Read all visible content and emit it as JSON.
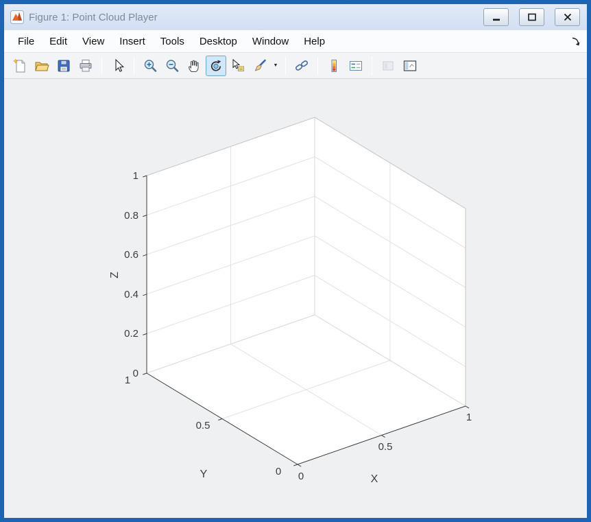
{
  "window": {
    "title": "Figure 1: Point Cloud Player",
    "app_icon": "matlab-logo",
    "controls": [
      "minimize",
      "maximize",
      "close"
    ]
  },
  "menu": {
    "items": [
      "File",
      "Edit",
      "View",
      "Insert",
      "Tools",
      "Desktop",
      "Window",
      "Help"
    ],
    "dock_icon": "dock-figure-arrow"
  },
  "toolbar": {
    "buttons": [
      "new-figure",
      "open-file",
      "save-figure",
      "print-figure",
      "edit-plot",
      "zoom-in",
      "zoom-out",
      "pan",
      "rotate-3d",
      "data-cursor",
      "brush-data",
      "link-plot",
      "insert-colorbar",
      "insert-legend",
      "hide-plot-tools",
      "show-plot-tools"
    ],
    "active_button": "rotate-3d",
    "disabled_buttons": [
      "hide-plot-tools"
    ],
    "brush_has_dropdown": true
  },
  "colors": {
    "window_border": "#1d64b4",
    "titlebar_bg": "#d7e3f3",
    "canvas_bg": "#eef0f2",
    "axes_wall": "#ffffff",
    "grid_line": "#e2e2e2",
    "active_tool_bg": "#cfe8fb",
    "active_tool_border": "#6fa8d6"
  },
  "chart_data": {
    "type": "scatter",
    "projection": "3d",
    "title": "",
    "xlabel": "X",
    "ylabel": "Y",
    "zlabel": "Z",
    "xlim": [
      0,
      1
    ],
    "ylim": [
      0,
      1
    ],
    "zlim": [
      0,
      1
    ],
    "xticks": [
      0,
      0.5,
      1
    ],
    "yticks": [
      0,
      0.5,
      1
    ],
    "zticks": [
      0,
      0.2,
      0.4,
      0.6,
      0.8,
      1
    ],
    "xtick_labels": [
      "0",
      "0.5",
      "1"
    ],
    "ytick_labels": [
      "0",
      "0.5",
      "1"
    ],
    "ztick_labels": [
      "0",
      "0.2",
      "0.4",
      "0.6",
      "0.8",
      "1"
    ],
    "grid": true,
    "view": {
      "azimuth": -37.5,
      "elevation": 30
    },
    "points": []
  }
}
